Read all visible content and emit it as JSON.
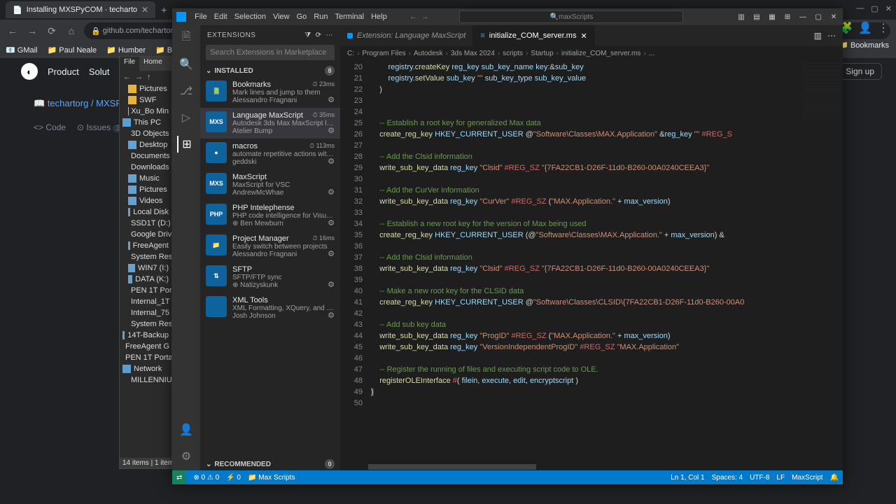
{
  "browser": {
    "tab_title": "Installing MXSPyCOM · techarto",
    "url": "github.com/techartorg/...",
    "bookmarks": [
      "GMail",
      "Paul Neale",
      "Humber",
      "Banking"
    ],
    "bookmarks_right": "Bookmarks",
    "signup": "Sign up"
  },
  "github": {
    "menu": [
      "Product",
      "Solut"
    ],
    "breadcrumb": "techartorg / MXSP",
    "tabs": {
      "code": "Code",
      "issues": "Issues",
      "issues_count": "3"
    }
  },
  "fileexplorer": {
    "tabs": {
      "file": "File",
      "home": "Home"
    },
    "items": [
      "Pictures",
      "SWF",
      "Xu_Bo Min"
    ],
    "pc": "This PC",
    "drives": [
      "3D Objects",
      "Desktop",
      "Documents",
      "Downloads",
      "Music",
      "Pictures",
      "Videos",
      "Local Disk",
      "SSD1T (D:)",
      "Google Driv",
      "FreeAgent",
      "System Res",
      "WIN7 (I:)",
      "DATA (K:)",
      "PEN 1T Por",
      "Internal_1T",
      "Internal_75",
      "System Res"
    ],
    "groups": [
      "14T-Backup",
      "FreeAgent G",
      "PEN 1T Porta"
    ],
    "network": "Network",
    "net_items": [
      "MILLENNIU"
    ],
    "status": "14 items  |  1 item"
  },
  "vscode": {
    "menu": [
      "File",
      "Edit",
      "Selection",
      "View",
      "Go",
      "Run",
      "Terminal",
      "Help"
    ],
    "search_placeholder": "maxScripts",
    "sidebar": {
      "title": "EXTENSIONS",
      "search_placeholder": "Search Extensions in Marketplace",
      "installed": "INSTALLED",
      "installed_count": "8",
      "recommended": "RECOMMENDED",
      "recommended_count": "0"
    },
    "extensions": [
      {
        "name": "Bookmarks",
        "desc": "Mark lines and jump to them",
        "pub": "Alessandro Fragnani",
        "meta": "⏱ 23ms",
        "icon": "📗"
      },
      {
        "name": "Language MaxScript",
        "desc": "Autodesk 3ds Max MaxScript languag...",
        "pub": "Atelier Bump",
        "meta": "⏱ 35ms",
        "icon": "MXS",
        "selected": true
      },
      {
        "name": "macros",
        "desc": "automate repetitive actions with custo...",
        "pub": "geddski",
        "meta": "⏱ 113ms",
        "icon": "●"
      },
      {
        "name": "MaxScript",
        "desc": "MaxScript for VSC",
        "pub": "AndrewMcWhae",
        "meta": "",
        "icon": "MXS"
      },
      {
        "name": "PHP Intelephense",
        "desc": "PHP code intelligence for Visual Studio...",
        "pub": "⊕ Ben Mewburn",
        "meta": "",
        "icon": "PHP"
      },
      {
        "name": "Project Manager",
        "desc": "Easily switch between projects",
        "pub": "Alessandro Fragnani",
        "meta": "⏱ 16ms",
        "icon": "📁"
      },
      {
        "name": "SFTP",
        "desc": "SFTP/FTP sync",
        "pub": "⊕ Natizyskunk",
        "meta": "",
        "icon": "⇅"
      },
      {
        "name": "XML Tools",
        "desc": "XML Formatting, XQuery, and XPath To...",
        "pub": "Josh Johnson",
        "meta": "",
        "icon": "</>"
      }
    ],
    "tabs": [
      {
        "label": "Extension: Language MaxScript",
        "active": false
      },
      {
        "label": "initialize_COM_server.ms",
        "active": true
      }
    ],
    "breadcrumb": [
      "C:",
      "Program Files",
      "Autodesk",
      "3ds Max 2024",
      "scripts",
      "Startup",
      "initialize_COM_server.ms",
      "..."
    ],
    "code_lines": [
      {
        "n": 20,
        "html": "        <span class='tk-v'>registry</span><span class='tk-p'>.</span><span class='tk-f'>createKey</span> <span class='tk-v'>reg_key</span> <span class='tk-v'>sub_key_name</span> <span class='tk-v'>key:</span><span class='tk-p'>&amp;</span><span class='tk-v'>sub_key</span>"
      },
      {
        "n": 21,
        "html": "        <span class='tk-v'>registry</span><span class='tk-p'>.</span><span class='tk-f'>setValue</span> <span class='tk-v'>sub_key</span> <span class='tk-s'>\"\"</span> <span class='tk-v'>sub_key_type</span> <span class='tk-v'>sub_key_value</span>"
      },
      {
        "n": 22,
        "html": "    <span class='tk-p'>)</span>"
      },
      {
        "n": 23,
        "html": ""
      },
      {
        "n": 24,
        "html": ""
      },
      {
        "n": 25,
        "html": "    <span class='tk-c'>-- Establish a root key for generalized Max data</span>"
      },
      {
        "n": 26,
        "html": "    <span class='tk-f'>create_reg_key</span> <span class='tk-v'>HKEY_CURRENT_USER</span> <span class='tk-p'>@</span><span class='tk-s'>\"Software\\Classes\\MAX.Application\"</span> <span class='tk-p'>&amp;</span><span class='tk-v'>reg_key</span> <span class='tk-s'>\"\"</span> <span class='tk-r'>#REG_S</span>"
      },
      {
        "n": 27,
        "html": ""
      },
      {
        "n": 28,
        "html": "    <span class='tk-c'>-- Add the Clsid information</span>"
      },
      {
        "n": 29,
        "html": "    <span class='tk-f'>write_sub_key_data</span> <span class='tk-v'>reg_key</span> <span class='tk-s'>\"Clsid\"</span> <span class='tk-r'>#REG_SZ</span> <span class='tk-s'>\"{7FA22CB1-D26F-11d0-B260-00A0240CEEA3}\"</span>"
      },
      {
        "n": 30,
        "html": ""
      },
      {
        "n": 31,
        "html": "    <span class='tk-c'>-- Add the CurVer information</span>"
      },
      {
        "n": 32,
        "html": "    <span class='tk-f'>write_sub_key_data</span> <span class='tk-v'>reg_key</span> <span class='tk-s'>\"CurVer\"</span> <span class='tk-r'>#REG_SZ</span> <span class='tk-p'>(</span><span class='tk-s'>\"MAX.Application.\"</span> <span class='tk-p'>+</span> <span class='tk-v'>max_version</span><span class='tk-p'>)</span>"
      },
      {
        "n": 33,
        "html": ""
      },
      {
        "n": 34,
        "html": "    <span class='tk-c'>-- Establish a new root key for the version of Max being used</span>"
      },
      {
        "n": 35,
        "html": "    <span class='tk-f'>create_reg_key</span> <span class='tk-v'>HKEY_CURRENT_USER</span> <span class='tk-p'>(@</span><span class='tk-s'>\"Software\\Classes\\MAX.Application.\"</span> <span class='tk-p'>+</span> <span class='tk-v'>max_version</span><span class='tk-p'>) &amp;</span>"
      },
      {
        "n": 36,
        "html": ""
      },
      {
        "n": 37,
        "html": "    <span class='tk-c'>-- Add the Clsid information</span>"
      },
      {
        "n": 38,
        "html": "    <span class='tk-f'>write_sub_key_data</span> <span class='tk-v'>reg_key</span> <span class='tk-s'>\"Clsid\"</span> <span class='tk-r'>#REG_SZ</span> <span class='tk-s'>\"{7FA22CB1-D26F-11d0-B260-00A0240CEEA3}\"</span>"
      },
      {
        "n": 39,
        "html": ""
      },
      {
        "n": 40,
        "html": "    <span class='tk-c'>-- Make a new root key for the CLSID data</span>"
      },
      {
        "n": 41,
        "html": "    <span class='tk-f'>create_reg_key</span> <span class='tk-v'>HKEY_CURRENT_USER</span> <span class='tk-p'>@</span><span class='tk-s'>\"Software\\Classes\\CLSID\\{7FA22CB1-D26F-11d0-B260-00A0</span>"
      },
      {
        "n": 42,
        "html": ""
      },
      {
        "n": 43,
        "html": "    <span class='tk-c'>-- Add sub key data</span>"
      },
      {
        "n": 44,
        "html": "    <span class='tk-f'>write_sub_key_data</span> <span class='tk-v'>reg_key</span> <span class='tk-s'>\"ProgID\"</span> <span class='tk-r'>#REG_SZ</span> <span class='tk-p'>(</span><span class='tk-s'>\"MAX.Application.\"</span> <span class='tk-p'>+</span> <span class='tk-v'>max_version</span><span class='tk-p'>)</span>"
      },
      {
        "n": 45,
        "html": "    <span class='tk-f'>write_sub_key_data</span> <span class='tk-v'>reg_key</span> <span class='tk-s'>\"VersionIndependentProgID\"</span> <span class='tk-r'>#REG_SZ</span> <span class='tk-s'>\"MAX.Application\"</span>"
      },
      {
        "n": 46,
        "html": ""
      },
      {
        "n": 47,
        "html": "    <span class='tk-c'>-- Register the running of files and executing script code to OLE.</span>"
      },
      {
        "n": 48,
        "html": "    <span class='tk-f'>registerOLEInterface</span> <span class='tk-r'>#</span><span class='tk-p'>(</span> <span class='tk-v'>filein</span><span class='tk-p'>,</span> <span class='tk-v'>execute</span><span class='tk-p'>,</span> <span class='tk-v'>edit</span><span class='tk-p'>,</span> <span class='tk-v'>encryptscript</span> <span class='tk-p'>)</span>"
      },
      {
        "n": 49,
        "html": "<span class='tk-p' style='background:#3a3d41'>)</span>"
      },
      {
        "n": 50,
        "html": ""
      }
    ],
    "status": {
      "errors": "⊗ 0 ⚠ 0",
      "radio": "⚡ 0",
      "folder": "📁 Max Scripts",
      "pos": "Ln 1, Col 1",
      "spaces": "Spaces: 4",
      "encoding": "UTF-8",
      "eol": "LF",
      "lang": "MaxScript",
      "bell": "🔔"
    }
  }
}
